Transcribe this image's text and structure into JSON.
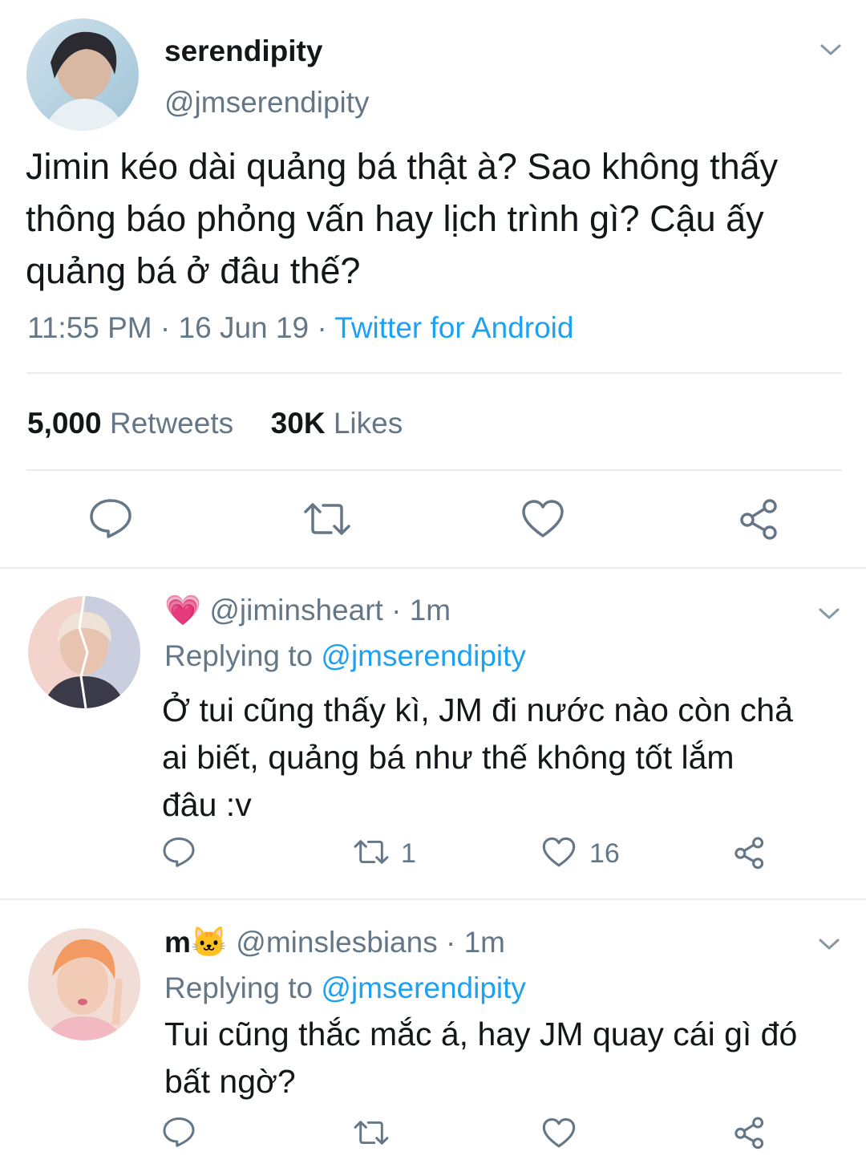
{
  "main_tweet": {
    "display_name": "serendipity",
    "handle": "@jmserendipity",
    "text_lines": [
      "Jimin kéo dài quảng bá thật à? Sao không thấy",
      "thông báo phỏng vấn hay lịch trình gì? Cậu ấy",
      "quảng bá ở đâu thế?"
    ],
    "time": "11:55 PM",
    "separator": "·",
    "date": "16 Jun 19",
    "source": "Twitter for Android",
    "retweets_count": "5,000",
    "retweets_label": "Retweets",
    "likes_count": "30K",
    "likes_label": "Likes"
  },
  "replies": [
    {
      "emoji": "💗",
      "handle": "@jiminsheart",
      "age": "· 1m",
      "replying_label": "Replying to",
      "replying_handle": "@jmserendipity",
      "text_lines": [
        "Ở tui cũng thấy kì, JM đi nước nào còn chả",
        "ai biết, quảng bá như thế không tốt lắm",
        "đâu :v"
      ],
      "retweet_count": "1",
      "like_count": "16"
    },
    {
      "name_prefix": "m",
      "emoji": "🐱",
      "handle": "@minslesbians",
      "age": "· 1m",
      "replying_label": "Replying to",
      "replying_handle": "@jmserendipity",
      "text_lines": [
        "Tui cũng thắc mắc á, hay JM quay cái gì đó",
        "bất ngờ?"
      ]
    }
  ],
  "colors": {
    "text": "#14171a",
    "muted": "#657786",
    "link": "#1da1f2",
    "divider": "#e6ecf0"
  }
}
